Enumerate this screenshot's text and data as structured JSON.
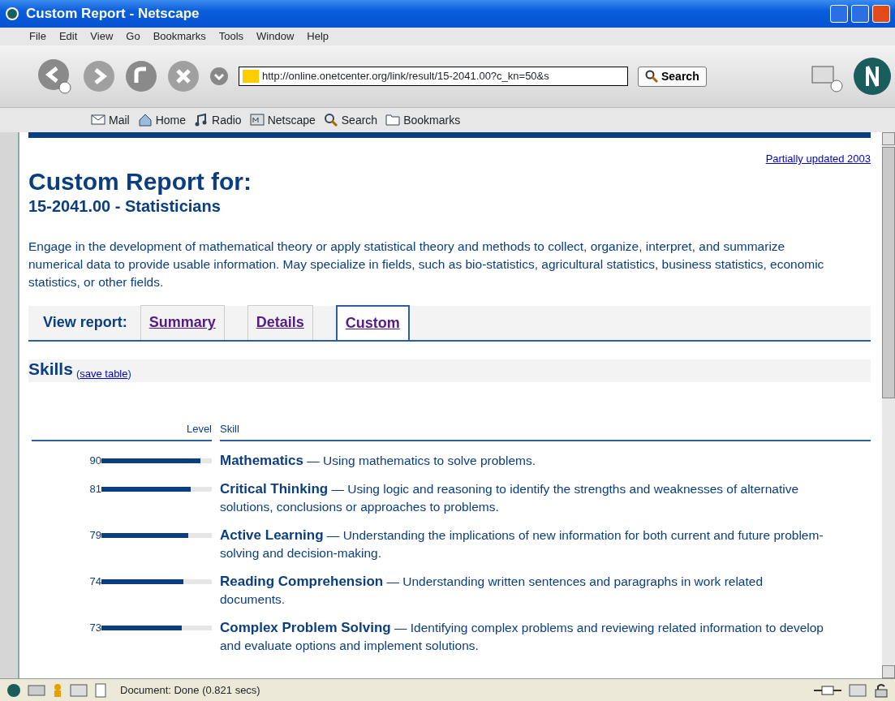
{
  "window": {
    "title": "Custom Report - Netscape"
  },
  "menu": [
    "File",
    "Edit",
    "View",
    "Go",
    "Bookmarks",
    "Tools",
    "Window",
    "Help"
  ],
  "navigation": {
    "url": "http://online.onetcenter.org/link/result/15-2041.00?c_kn=50&s",
    "search_button": "Search"
  },
  "personal_toolbar": [
    "Mail",
    "Home",
    "Radio",
    "Netscape",
    "Search",
    "Bookmarks"
  ],
  "page": {
    "updated_link": "Partially updated 2003",
    "heading": "Custom Report for:",
    "subheading": "15-2041.00 - Statisticians",
    "description": "Engage in the development of mathematical theory or apply statistical theory and methods to collect, organize, interpret, and summarize numerical data to provide usable information. May specialize in fields, such as bio-statistics, agricultural statistics, business statistics, economic statistics, or other fields.",
    "view_label": "View report:",
    "tabs": [
      {
        "label": "Summary",
        "selected": false
      },
      {
        "label": "Details",
        "selected": false
      },
      {
        "label": "Custom",
        "selected": true
      }
    ],
    "section": {
      "title": "Skills",
      "open_paren": "(",
      "save_link": "save table",
      "close_paren": ")"
    },
    "table": {
      "columns": [
        "Level",
        "Skill"
      ],
      "rows": [
        {
          "value": "90",
          "level": 0.9,
          "name": "Mathematics",
          "description": "— Using mathematics to solve problems."
        },
        {
          "value": "81",
          "level": 0.81,
          "name": "Critical Thinking",
          "description": "— Using logic and reasoning to identify the strengths and weaknesses of alternative solutions, conclusions or approaches to problems."
        },
        {
          "value": "79",
          "level": 0.79,
          "name": "Active Learning",
          "description": "— Understanding the implications of new information for both current and future problem-solving and decision-making."
        },
        {
          "value": "74",
          "level": 0.74,
          "name": "Reading Comprehension",
          "description": "— Understanding written sentences and paragraphs in work related documents."
        },
        {
          "value": "73",
          "level": 0.73,
          "name": "Complex Problem Solving",
          "description": "— Identifying complex problems and reviewing related information to develop and evaluate options and implement solutions."
        }
      ]
    }
  },
  "status_bar": {
    "text": "Document: Done (0.821 secs)"
  }
}
